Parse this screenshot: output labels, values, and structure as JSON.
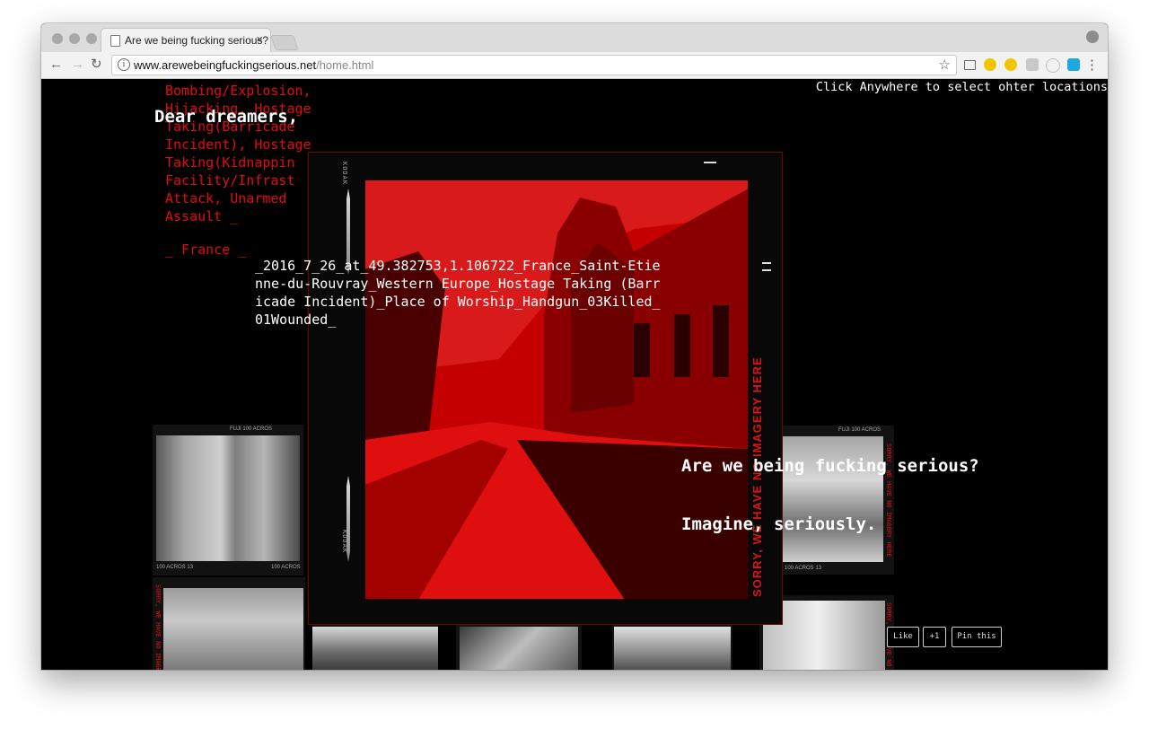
{
  "browser": {
    "tab_title": "Are we being fucking serious?",
    "tab_close": "×",
    "url_host": "www.arewebeingfuckingserious.net",
    "url_path": "/home.html",
    "back": "←",
    "forward": "→",
    "reload": "↻",
    "star": "☆",
    "menu": "⋮",
    "info": "i"
  },
  "page": {
    "incident_types": "Bombing/Explosion, Hijacking, Hostage Taking(Barricade Incident), Hostage Taking(Kidnappin Facility/Infrast Attack, Unarmed Assault _",
    "country": "_ France _",
    "greeting": "Dear dreamers,",
    "hint": "Click Anywhere to select ohter locations",
    "location_caption": "_2016_7_26_at_49.382753,1.106722_France_Saint-Etienne-du-Rouvray_Western Europe_Hostage Taking (Barricade Incident)_Place of Worship_Handgun_03Killed_01Wounded_",
    "headline_1": "Are we being fucking serious?",
    "headline_2": "Imagine, seriously.",
    "photo_side_label": "SORRY, WE HAVE NO IMAGERY HERE",
    "film_code": "KODAK",
    "thumb_top": "FUJI 100 ACROS",
    "thumb_bottom": "100 ACROS 13",
    "thumb_bottom_right": "100 ACROS",
    "thumb_strip": "SORRY, WE HAVE NO IMAGERY HERE",
    "social": {
      "like": "Like",
      "plus_one": "+1",
      "pin": "Pin this"
    }
  },
  "colors": {
    "accent_red": "#e00d0d",
    "photo_red": "#b00000",
    "background": "#000000",
    "text": "#ffffff"
  }
}
